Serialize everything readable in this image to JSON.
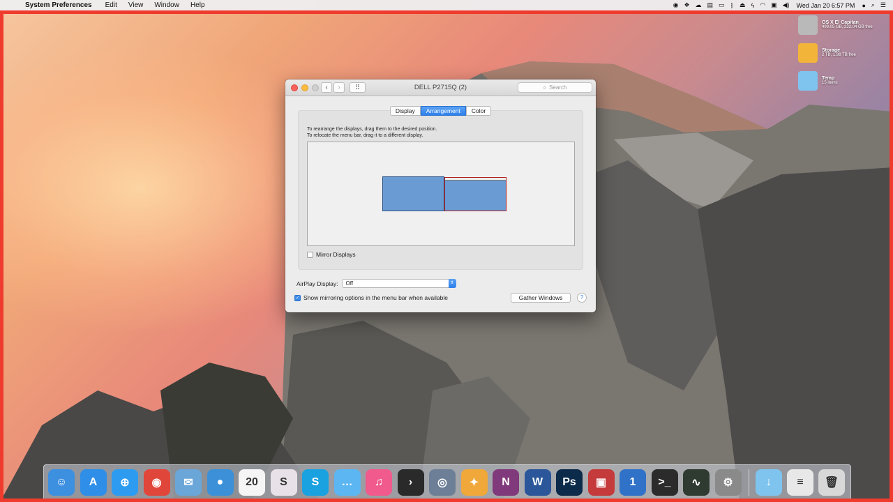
{
  "menubar": {
    "app_name": "System Preferences",
    "menus": [
      "Edit",
      "View",
      "Window",
      "Help"
    ],
    "clock": "Wed Jan 20  6:57 PM"
  },
  "desktop_icons": [
    {
      "name": "OS X El Capitan",
      "sub": "499.05 GB, 232.04 GB free",
      "icon": "hard-drive-icon",
      "color": "#b9b9b9"
    },
    {
      "name": "Storage",
      "sub": "2 TB, 1.98 TB free",
      "icon": "external-drive-icon",
      "color": "#f3b43a"
    },
    {
      "name": "Temp",
      "sub": "15 items",
      "icon": "folder-icon",
      "color": "#7fc4ee"
    }
  ],
  "window": {
    "title": "DELL P2715Q (2)",
    "search_placeholder": "Search",
    "tabs": [
      {
        "label": "Display",
        "active": false
      },
      {
        "label": "Arrangement",
        "active": true
      },
      {
        "label": "Color",
        "active": false
      }
    ],
    "instructions_line1": "To rearrange the displays, drag them to the desired position.",
    "instructions_line2": "To relocate the menu bar, drag it to a different display.",
    "mirror_label": "Mirror Displays",
    "mirror_checked": false,
    "airplay_label": "AirPlay Display:",
    "airplay_value": "Off",
    "show_mirroring_label": "Show mirroring options in the menu bar when available",
    "show_mirroring_checked": true,
    "gather_label": "Gather Windows",
    "help_label": "?"
  },
  "dock": {
    "apps": [
      {
        "name": "Finder",
        "glyph": "☺",
        "color": "#3d8fe0"
      },
      {
        "name": "App Store",
        "glyph": "A",
        "color": "#2f8ee8"
      },
      {
        "name": "Safari",
        "glyph": "⊕",
        "color": "#2d9cf0"
      },
      {
        "name": "Chrome",
        "glyph": "◉",
        "color": "#e1463a"
      },
      {
        "name": "Mail",
        "glyph": "✉",
        "color": "#6aa6d8"
      },
      {
        "name": "Tweetbot",
        "glyph": "●",
        "color": "#3b90d8"
      },
      {
        "name": "Calendar",
        "glyph": "20",
        "color": "#f5f5f5"
      },
      {
        "name": "Slack",
        "glyph": "S",
        "color": "#e8e2e8"
      },
      {
        "name": "Skype",
        "glyph": "S",
        "color": "#1aa1e0"
      },
      {
        "name": "Messages",
        "glyph": "…",
        "color": "#5bb6f2"
      },
      {
        "name": "iTunes",
        "glyph": "♫",
        "color": "#f05a8c"
      },
      {
        "name": "Plex",
        "glyph": "›",
        "color": "#2a2a2a"
      },
      {
        "name": "Preview",
        "glyph": "◎",
        "color": "#6d7f97"
      },
      {
        "name": "Tes",
        "glyph": "✦",
        "color": "#f0a83a"
      },
      {
        "name": "OneNote",
        "glyph": "N",
        "color": "#80397b"
      },
      {
        "name": "Word",
        "glyph": "W",
        "color": "#2b579a"
      },
      {
        "name": "Photoshop",
        "glyph": "Ps",
        "color": "#0c2a4a"
      },
      {
        "name": "Parallels",
        "glyph": "▣",
        "color": "#c53a3a"
      },
      {
        "name": "1Password",
        "glyph": "1",
        "color": "#2f72c8"
      },
      {
        "name": "Terminal",
        "glyph": ">_",
        "color": "#2b2b2b"
      },
      {
        "name": "Activity Monitor",
        "glyph": "∿",
        "color": "#2f3b30"
      },
      {
        "name": "System Preferences",
        "glyph": "⚙",
        "color": "#8a8a8a"
      }
    ],
    "right": [
      {
        "name": "Downloads",
        "glyph": "↓",
        "color": "#7fc4ee"
      },
      {
        "name": "Documents",
        "glyph": "≡",
        "color": "#e8e8e8"
      },
      {
        "name": "Trash",
        "glyph": "🗑",
        "color": "#d8d8d8"
      }
    ]
  }
}
